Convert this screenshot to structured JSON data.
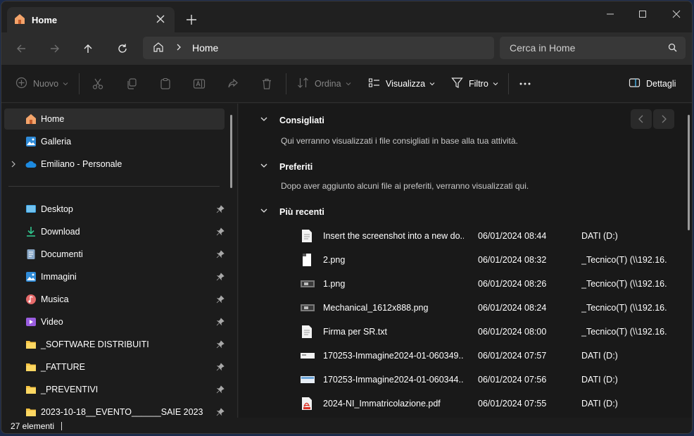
{
  "tab": {
    "title": "Home"
  },
  "window_controls": {
    "minimize": "—",
    "maximize": "☐",
    "close": "✕"
  },
  "address": {
    "crumb": "Home"
  },
  "search": {
    "placeholder": "Cerca in Home"
  },
  "toolbar": {
    "new_label": "Nuovo",
    "sort_label": "Ordina",
    "view_label": "Visualizza",
    "filter_label": "Filtro",
    "details_label": "Dettagli"
  },
  "sidebar": {
    "top": [
      {
        "label": "Home"
      },
      {
        "label": "Galleria"
      },
      {
        "label": "Emiliano - Personale"
      }
    ],
    "pinned": [
      {
        "label": "Desktop"
      },
      {
        "label": "Download"
      },
      {
        "label": "Documenti"
      },
      {
        "label": "Immagini"
      },
      {
        "label": "Musica"
      },
      {
        "label": "Video"
      },
      {
        "label": "_SOFTWARE DISTRIBUITI"
      },
      {
        "label": "_FATTURE"
      },
      {
        "label": "_PREVENTIVI"
      },
      {
        "label": "2023-10-18__EVENTO______SAIE 2023"
      }
    ]
  },
  "main": {
    "sections": [
      {
        "title": "Consigliati",
        "hint": "Qui verranno visualizzati i file consigliati in base alla tua attività."
      },
      {
        "title": "Preferiti",
        "hint": "Dopo aver aggiunto alcuni file ai preferiti, verranno visualizzati qui."
      },
      {
        "title": "Più recenti"
      }
    ],
    "recent": [
      {
        "name": "Insert the screenshot into a new do...",
        "date": "06/01/2024 08:44",
        "location": "DATI (D:)",
        "icon": "doc-icon"
      },
      {
        "name": "2.png",
        "date": "06/01/2024 08:32",
        "location": "_Tecnico(T) (\\\\192.16...",
        "icon": "image-file-icon"
      },
      {
        "name": "1.png",
        "date": "06/01/2024 08:26",
        "location": "_Tecnico(T) (\\\\192.16...",
        "icon": "image-thumb-icon"
      },
      {
        "name": "Mechanical_1612x888.png",
        "date": "06/01/2024 08:24",
        "location": "_Tecnico(T) (\\\\192.16...",
        "icon": "image-thumb-icon"
      },
      {
        "name": "Firma per SR.txt",
        "date": "06/01/2024 08:00",
        "location": "_Tecnico(T) (\\\\192.16...",
        "icon": "txt-icon"
      },
      {
        "name": "170253-Immagine2024-01-060349...",
        "date": "06/01/2024 07:57",
        "location": "DATI (D:)",
        "icon": "image-thumb-icon"
      },
      {
        "name": "170253-Immagine2024-01-060344...",
        "date": "06/01/2024 07:56",
        "location": "DATI (D:)",
        "icon": "image-thumb-icon"
      },
      {
        "name": "2024-NI_Immatricolazione.pdf",
        "date": "06/01/2024 07:55",
        "location": "DATI (D:)",
        "icon": "pdf-icon"
      }
    ]
  },
  "status": {
    "count": "27 elementi"
  },
  "colors": {
    "accent": "#4cc2ff",
    "folder": "#f6c342",
    "window_bg": "#202020"
  }
}
